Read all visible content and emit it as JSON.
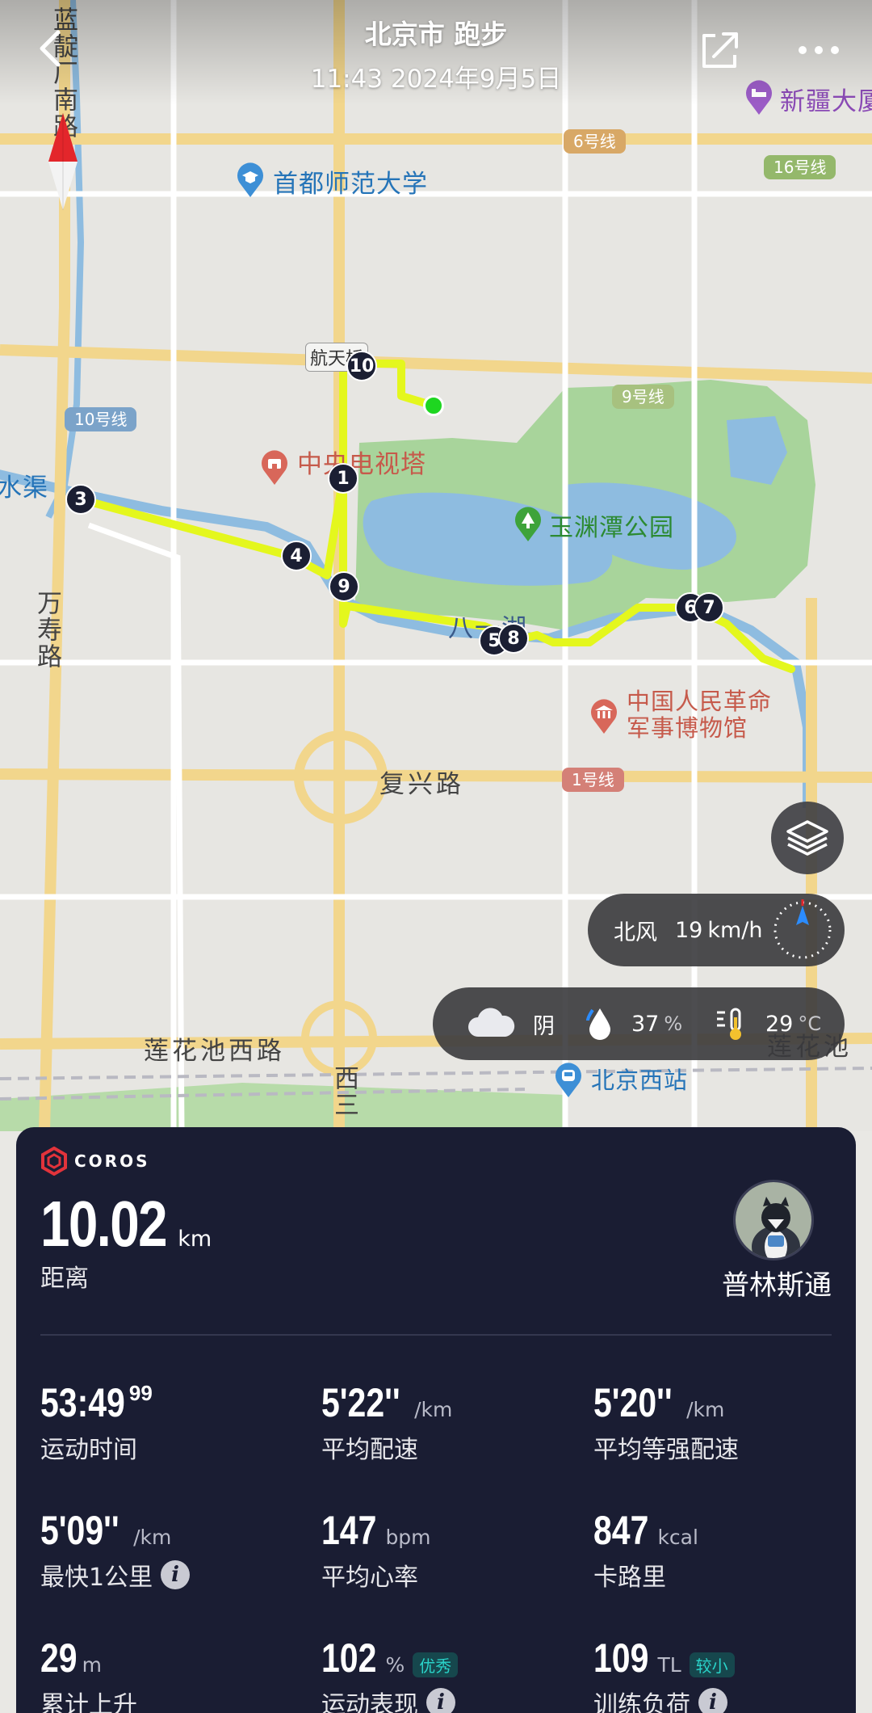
{
  "header": {
    "title": "北京市 跑步",
    "subtitle": "11:43 2024年9月5日"
  },
  "map": {
    "roads": {
      "lanchang": "蓝靛厂南路",
      "wanshou": "万寿路",
      "fuxing": "复兴路",
      "lianhuachi_west": "莲花池西路",
      "lianhuachi": "莲花池",
      "xisan": "西三",
      "shuiqu": "水渠",
      "bayi_lake": "八一湖"
    },
    "bridge": "航天桥",
    "lines": {
      "line6": "6号线",
      "line16": "16号线",
      "line9": "9号线",
      "line10": "10号线",
      "line1": "1号线"
    },
    "pois": {
      "university": "首都师范大学",
      "tv_tower": "中央电视塔",
      "park": "玉渊潭公园",
      "museum": "中国人民革命\n军事博物馆",
      "station": "北京西站",
      "hotel": "新疆大厦"
    },
    "km_markers": [
      "1",
      "3",
      "4",
      "5",
      "6",
      "7",
      "8",
      "9",
      "10"
    ]
  },
  "weather": {
    "wind_direction": "北风",
    "wind_speed": "19",
    "wind_unit": "km/h",
    "condition": "阴",
    "humidity": "37",
    "humidity_unit": "%",
    "temperature": "29",
    "temperature_unit": "°C"
  },
  "card": {
    "brand": "COROS",
    "distance": "10.02",
    "distance_unit": "km",
    "distance_label": "距离",
    "user_name": "普林斯通",
    "stats": {
      "time": {
        "value": "53:49",
        "sup": "99",
        "label": "运动时间"
      },
      "avg_pace": {
        "value": "5'22''",
        "unit": "/km",
        "label": "平均配速"
      },
      "grade_pace": {
        "value": "5'20''",
        "unit": "/km",
        "label": "平均等强配速"
      },
      "fastest_km": {
        "value": "5'09''",
        "unit": "/km",
        "label": "最快1公里"
      },
      "avg_hr": {
        "value": "147",
        "unit": "bpm",
        "label": "平均心率"
      },
      "calories": {
        "value": "847",
        "unit": "kcal",
        "label": "卡路里"
      },
      "ascent": {
        "value": "29",
        "unit": "m",
        "label": "累计上升"
      },
      "performance": {
        "value": "102",
        "unit": "%",
        "tag": "优秀",
        "label": "运动表现"
      },
      "training_load": {
        "value": "109",
        "unit": "TL",
        "tag": "较小",
        "label": "训练负荷"
      }
    }
  },
  "colors": {
    "route": "#e4f71d",
    "card_bg": "#1a1d33",
    "brand_red": "#e2333b",
    "tag_text": "#2ad3c9"
  },
  "icons": [
    "back-icon",
    "share-icon",
    "more-icon",
    "compass-icon",
    "layers-icon",
    "cloud-icon",
    "humidity-icon",
    "thermometer-icon",
    "coros-logo",
    "info-icon"
  ]
}
